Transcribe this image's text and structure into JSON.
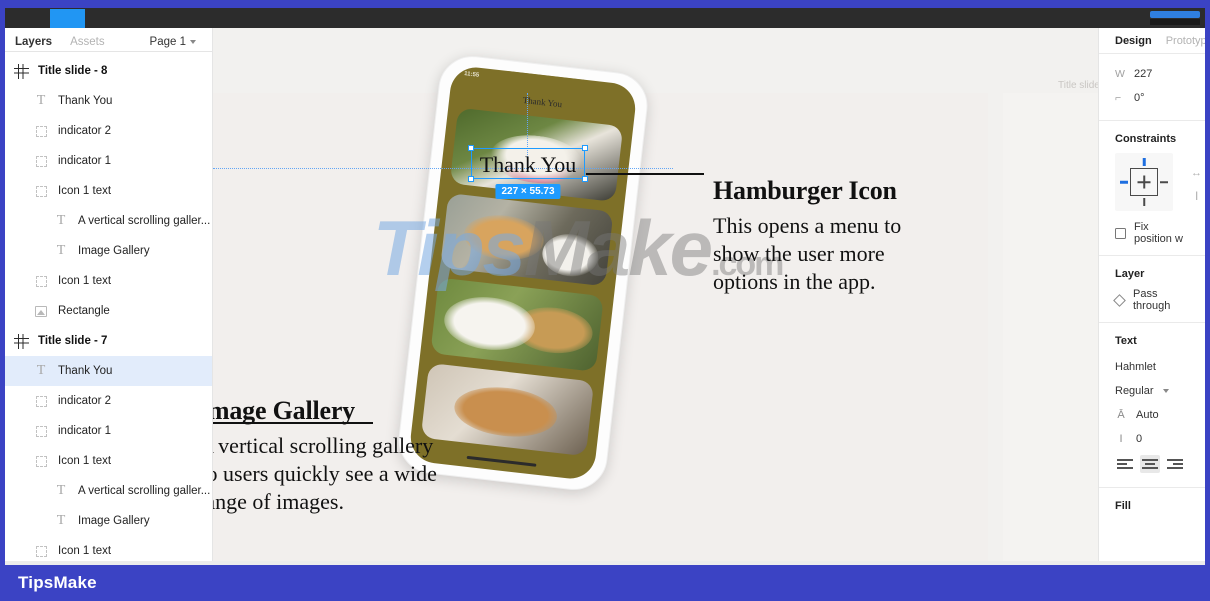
{
  "toolbar": {
    "menu_icon": "figma-menu-icon",
    "active_tool": "move-tool",
    "present_label": "",
    "share_label": ""
  },
  "left_panel": {
    "tabs": [
      {
        "label": "Layers",
        "active": true
      },
      {
        "label": "Assets",
        "active": false
      }
    ],
    "page_selector": {
      "label": "Page 1",
      "icon": "chevron-down-icon"
    },
    "layers": [
      {
        "label": "Title slide - 8",
        "icon": "frame-icon",
        "type": "frame",
        "indent": 0,
        "selected": false
      },
      {
        "label": "Thank You",
        "icon": "text-icon",
        "type": "text",
        "indent": 1,
        "selected": false
      },
      {
        "label": "indicator 2",
        "icon": "group-icon",
        "type": "group",
        "indent": 1,
        "selected": false
      },
      {
        "label": "indicator 1",
        "icon": "group-icon",
        "type": "group",
        "indent": 1,
        "selected": false
      },
      {
        "label": "Icon 1 text",
        "icon": "group-icon",
        "type": "group",
        "indent": 1,
        "selected": false
      },
      {
        "label": "A vertical scrolling galler...",
        "icon": "text-icon",
        "type": "text",
        "indent": 2,
        "selected": false
      },
      {
        "label": "Image Gallery",
        "icon": "text-icon",
        "type": "text",
        "indent": 2,
        "selected": false
      },
      {
        "label": "Icon 1 text",
        "icon": "group-icon",
        "type": "group",
        "indent": 1,
        "selected": false
      },
      {
        "label": "Rectangle",
        "icon": "image-icon",
        "type": "image",
        "indent": 1,
        "selected": false
      },
      {
        "label": "Title slide - 7",
        "icon": "frame-icon",
        "type": "frame",
        "indent": 0,
        "selected": false
      },
      {
        "label": "Thank You",
        "icon": "text-icon",
        "type": "text",
        "indent": 1,
        "selected": true
      },
      {
        "label": "indicator 2",
        "icon": "group-icon",
        "type": "group",
        "indent": 1,
        "selected": false
      },
      {
        "label": "indicator 1",
        "icon": "group-icon",
        "type": "group",
        "indent": 1,
        "selected": false
      },
      {
        "label": "Icon 1 text",
        "icon": "group-icon",
        "type": "group",
        "indent": 1,
        "selected": false
      },
      {
        "label": "A vertical scrolling galler...",
        "icon": "text-icon",
        "type": "text",
        "indent": 2,
        "selected": false
      },
      {
        "label": "Image Gallery",
        "icon": "text-icon",
        "type": "text",
        "indent": 2,
        "selected": false
      },
      {
        "label": "Icon 1 text",
        "icon": "group-icon",
        "type": "group",
        "indent": 1,
        "selected": false
      }
    ]
  },
  "canvas": {
    "artboard_label": "Title slide",
    "selection": {
      "text": "Thank You",
      "dimensions_badge": "227 × 55.73"
    },
    "phone": {
      "status_time": "11:55",
      "screen_title": "Thank You"
    },
    "annotation_right": {
      "title": "Hamburger Icon",
      "body": "This opens a menu to show the user more options in the app."
    },
    "annotation_left": {
      "title": "Image Gallery",
      "body": "A vertical scrolling gallery so users quickly see a wide range of images."
    },
    "watermark": {
      "part1": "Tips",
      "part2": "Make",
      "part3": ".com"
    }
  },
  "right_panel": {
    "tabs": [
      {
        "label": "Design",
        "active": true
      },
      {
        "label": "Prototype",
        "active": false
      }
    ],
    "dimensions": {
      "width_label": "W",
      "width_value": "227",
      "rotation_icon": "angle-icon",
      "rotation_value": "0°"
    },
    "constraints": {
      "title": "Constraints",
      "fix_position_label": "Fix position w",
      "horizontal_icon": "horizontal-constraint-icon",
      "vertical_icon": "vertical-constraint-icon"
    },
    "layer": {
      "title": "Layer",
      "blend_mode": "Pass through",
      "blend_icon": "blend-mode-icon"
    },
    "text": {
      "title": "Text",
      "font_family": "Hahmlet",
      "font_style": "Regular",
      "style_chevron": "chevron-down-icon",
      "line_height_icon": "line-height-icon",
      "line_height": "Auto",
      "letter_spacing_icon": "letter-spacing-icon",
      "letter_spacing": "0",
      "align_left_icon": "align-left-icon",
      "align_center_icon": "align-center-icon",
      "align_right_icon": "align-right-icon"
    },
    "fill": {
      "title": "Fill"
    }
  },
  "brand_bar": {
    "label": "TipsMake"
  },
  "colors": {
    "brand": "#3b43c4",
    "selection": "#1e9bff",
    "toolbar": "#2c2c2c",
    "canvas_bg": "#f2f1ef",
    "phone_screen": "#7e7028"
  }
}
